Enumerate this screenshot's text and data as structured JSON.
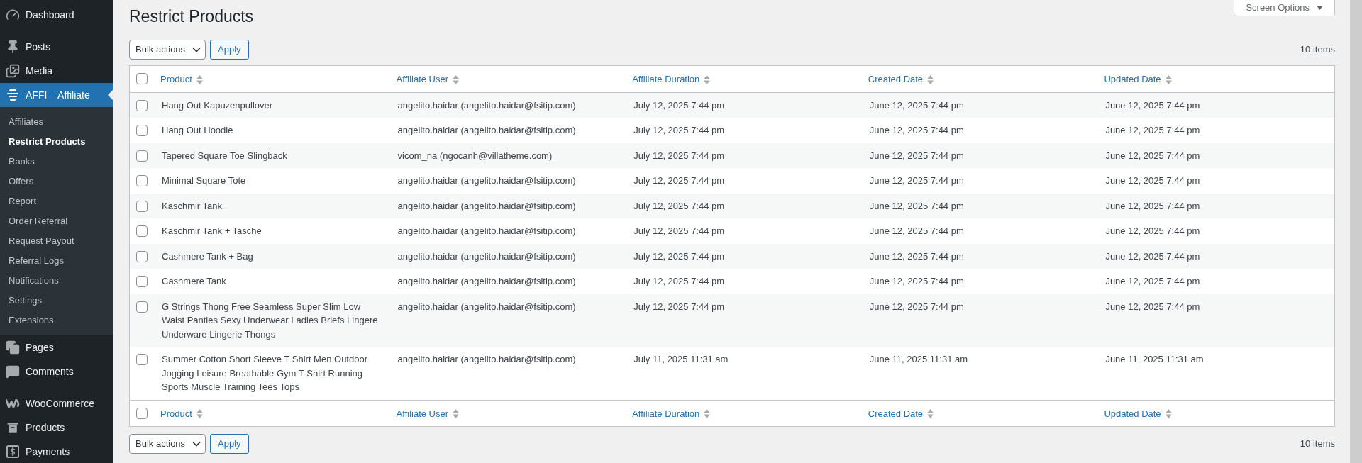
{
  "sidebar": {
    "groups": [
      {
        "items": [
          {
            "label": "Dashboard",
            "selected": false
          }
        ]
      },
      {
        "items": [
          {
            "label": "Posts",
            "selected": false
          },
          {
            "label": "Media",
            "selected": false
          },
          {
            "label": "AFFI – Affiliate",
            "selected": true,
            "children": [
              {
                "label": "Affiliates",
                "selected": false
              },
              {
                "label": "Restrict Products",
                "selected": true
              },
              {
                "label": "Ranks",
                "selected": false
              },
              {
                "label": "Offers",
                "selected": false
              },
              {
                "label": "Report",
                "selected": false
              },
              {
                "label": "Order Referral",
                "selected": false
              },
              {
                "label": "Request Payout",
                "selected": false
              },
              {
                "label": "Referral Logs",
                "selected": false
              },
              {
                "label": "Notifications",
                "selected": false
              },
              {
                "label": "Settings",
                "selected": false
              },
              {
                "label": "Extensions",
                "selected": false
              }
            ]
          },
          {
            "label": "Pages",
            "selected": false
          },
          {
            "label": "Comments",
            "selected": false
          }
        ]
      },
      {
        "items": [
          {
            "label": "WooCommerce",
            "selected": false
          },
          {
            "label": "Products",
            "selected": false
          },
          {
            "label": "Payments",
            "selected": false
          }
        ]
      }
    ]
  },
  "page": {
    "title": "Restrict Products",
    "screen_options": "Screen Options"
  },
  "top_nav": {
    "bulk_actions": "Bulk actions",
    "apply": "Apply",
    "count": "10 items"
  },
  "table": {
    "select_all_checked": false,
    "columns": [
      "Product",
      "Affiliate User",
      "Affiliate Duration",
      "Created Date",
      "Updated Date"
    ],
    "rows": [
      {
        "checked": false,
        "cells": [
          "Hang Out Kapuzenpullover",
          "angelito.haidar (angelito.haidar@fsitip.com)",
          "July 12, 2025 7:44 pm",
          "June 12, 2025 7:44 pm",
          "June 12, 2025 7:44 pm"
        ]
      },
      {
        "checked": false,
        "cells": [
          "Hang Out Hoodie",
          "angelito.haidar (angelito.haidar@fsitip.com)",
          "July 12, 2025 7:44 pm",
          "June 12, 2025 7:44 pm",
          "June 12, 2025 7:44 pm"
        ]
      },
      {
        "checked": false,
        "cells": [
          "Tapered Square Toe Slingback",
          "vicom_na (ngocanh@villatheme.com)",
          "July 12, 2025 7:44 pm",
          "June 12, 2025 7:44 pm",
          "June 12, 2025 7:44 pm"
        ]
      },
      {
        "checked": false,
        "cells": [
          "Minimal Square Tote",
          "angelito.haidar (angelito.haidar@fsitip.com)",
          "July 12, 2025 7:44 pm",
          "June 12, 2025 7:44 pm",
          "June 12, 2025 7:44 pm"
        ]
      },
      {
        "checked": false,
        "cells": [
          "Kaschmir Tank",
          "angelito.haidar (angelito.haidar@fsitip.com)",
          "July 12, 2025 7:44 pm",
          "June 12, 2025 7:44 pm",
          "June 12, 2025 7:44 pm"
        ]
      },
      {
        "checked": false,
        "cells": [
          "Kaschmir Tank + Tasche",
          "angelito.haidar (angelito.haidar@fsitip.com)",
          "July 12, 2025 7:44 pm",
          "June 12, 2025 7:44 pm",
          "June 12, 2025 7:44 pm"
        ]
      },
      {
        "checked": false,
        "cells": [
          "Cashmere Tank + Bag",
          "angelito.haidar (angelito.haidar@fsitip.com)",
          "July 12, 2025 7:44 pm",
          "June 12, 2025 7:44 pm",
          "June 12, 2025 7:44 pm"
        ]
      },
      {
        "checked": false,
        "cells": [
          "Cashmere Tank",
          "angelito.haidar (angelito.haidar@fsitip.com)",
          "July 12, 2025 7:44 pm",
          "June 12, 2025 7:44 pm",
          "June 12, 2025 7:44 pm"
        ]
      },
      {
        "checked": false,
        "cells": [
          "G Strings Thong Free Seamless Super Slim Low Waist Panties Sexy Underwear Ladies Briefs Lingere Underware Lingerie Thongs",
          "angelito.haidar (angelito.haidar@fsitip.com)",
          "July 12, 2025 7:44 pm",
          "June 12, 2025 7:44 pm",
          "June 12, 2025 7:44 pm"
        ]
      },
      {
        "checked": false,
        "cells": [
          "Summer Cotton Short Sleeve T Shirt Men Outdoor Jogging Leisure Breathable Gym T-Shirt Running Sports Muscle Training Tees Tops",
          "angelito.haidar (angelito.haidar@fsitip.com)",
          "July 11, 2025 11:31 am",
          "June 11, 2025 11:31 am",
          "June 11, 2025 11:31 am"
        ]
      }
    ],
    "footer_select_all_checked": false,
    "footer_columns": [
      "Product",
      "Affiliate User",
      "Affiliate Duration",
      "Created Date",
      "Updated Date"
    ]
  },
  "bottom_nav": {
    "bulk_actions": "Bulk actions",
    "apply": "Apply",
    "count": "10 items"
  }
}
